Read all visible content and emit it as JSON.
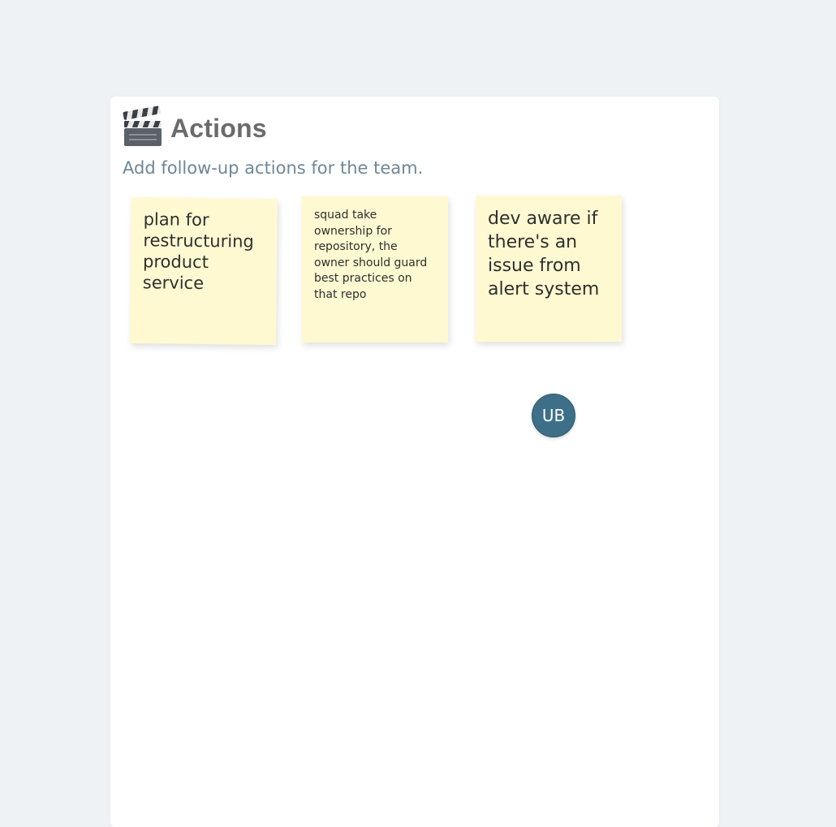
{
  "board": {
    "title": "Actions",
    "subtitle": "Add follow-up actions for the team.",
    "icon": "clapper-board-icon"
  },
  "notes": [
    {
      "text": "plan for restructuring product service"
    },
    {
      "text": "squad take ownership for repository, the owner should guard best practices on that repo"
    },
    {
      "text": "dev aware if there's an issue from alert system"
    }
  ],
  "avatar": {
    "initials": "UB",
    "color": "#3d7088"
  },
  "colors": {
    "background": "#eef2f5",
    "note": "#fef9d1"
  }
}
